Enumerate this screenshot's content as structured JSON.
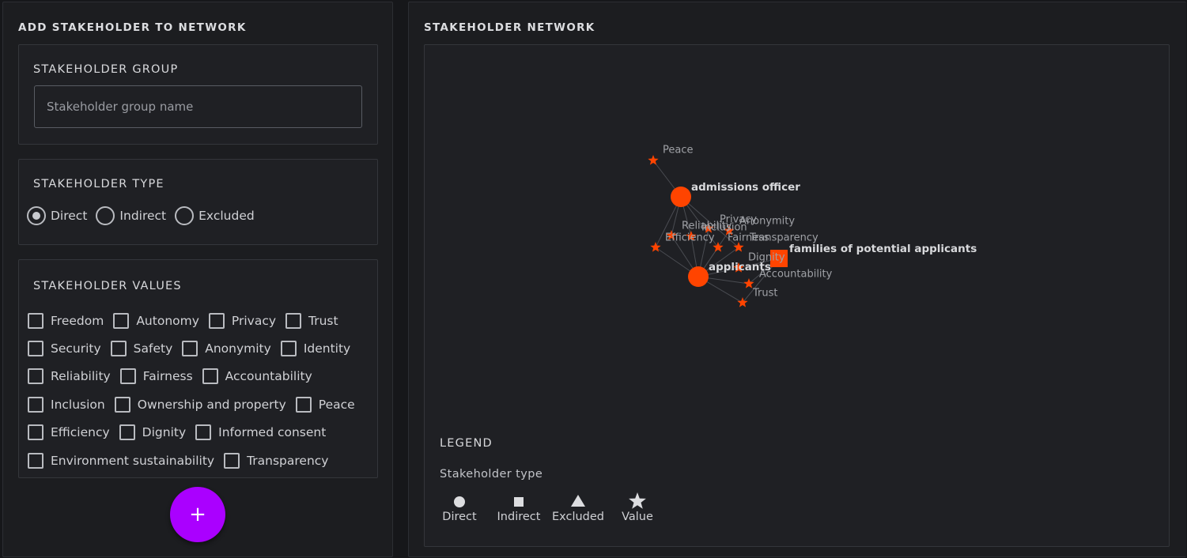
{
  "left_panel": {
    "title": "ADD STAKEHOLDER TO NETWORK",
    "group": {
      "title": "STAKEHOLDER GROUP",
      "input_value": "",
      "input_placeholder": "Stakeholder group name"
    },
    "type": {
      "title": "STAKEHOLDER TYPE",
      "options": [
        "Direct",
        "Indirect",
        "Excluded"
      ],
      "selected": "Direct"
    },
    "values": {
      "title": "STAKEHOLDER VALUES",
      "rows": [
        [
          "Freedom",
          "Autonomy",
          "Privacy",
          "Trust"
        ],
        [
          "Security",
          "Safety",
          "Anonymity",
          "Identity"
        ],
        [
          "Reliability",
          "Fairness",
          "Accountability"
        ],
        [
          "Inclusion",
          "Ownership and property",
          "Peace"
        ],
        [
          "Efficiency",
          "Dignity",
          "Informed consent"
        ],
        [
          "Environment sustainability",
          "Transparency"
        ]
      ],
      "checked": []
    },
    "add_button_label": "+",
    "add_button_color": "#aa00ff"
  },
  "right_panel": {
    "title": "STAKEHOLDER NETWORK",
    "legend": {
      "title": "LEGEND",
      "subtitle": "Stakeholder type",
      "items": [
        {
          "label": "Direct",
          "icon": "circle-icon"
        },
        {
          "label": "Indirect",
          "icon": "square-icon"
        },
        {
          "label": "Excluded",
          "icon": "triangle-icon"
        },
        {
          "label": "Value",
          "icon": "star-icon"
        }
      ]
    }
  },
  "network": {
    "node_color": "#ff4400",
    "stakeholders": [
      {
        "id": "admissions officer",
        "label": "admissions officer",
        "type": "Direct"
      },
      {
        "id": "applicants",
        "label": "applicants",
        "type": "Direct"
      },
      {
        "id": "families of potential applicants",
        "label": "families of potential applicants",
        "type": "Indirect"
      }
    ],
    "values": [
      {
        "id": "Peace",
        "label": "Peace"
      },
      {
        "id": "Privacy",
        "label": "Privacy"
      },
      {
        "id": "Anonymity",
        "label": "Anonymity"
      },
      {
        "id": "Reliability",
        "label": "Reliability"
      },
      {
        "id": "Inclusion",
        "label": "Inclusion"
      },
      {
        "id": "Efficiency",
        "label": "Efficiency"
      },
      {
        "id": "Fairness",
        "label": "Fairness"
      },
      {
        "id": "Transparency",
        "label": "Transparency"
      },
      {
        "id": "Dignity",
        "label": "Dignity"
      },
      {
        "id": "Accountability",
        "label": "Accountability"
      },
      {
        "id": "Trust",
        "label": "Trust"
      }
    ],
    "edges": [
      [
        "admissions officer",
        "Peace"
      ],
      [
        "admissions officer",
        "Efficiency"
      ],
      [
        "admissions officer",
        "Reliability"
      ],
      [
        "admissions officer",
        "Inclusion"
      ],
      [
        "admissions officer",
        "Fairness"
      ],
      [
        "admissions officer",
        "Transparency"
      ],
      [
        "applicants",
        "Efficiency"
      ],
      [
        "applicants",
        "Reliability"
      ],
      [
        "applicants",
        "Inclusion"
      ],
      [
        "applicants",
        "Privacy"
      ],
      [
        "applicants",
        "Fairness"
      ],
      [
        "applicants",
        "Anonymity"
      ],
      [
        "applicants",
        "Transparency"
      ],
      [
        "applicants",
        "Dignity"
      ],
      [
        "applicants",
        "Accountability"
      ],
      [
        "applicants",
        "Trust"
      ],
      [
        "families of potential applicants",
        "Dignity"
      ],
      [
        "families of potential applicants",
        "Accountability"
      ],
      [
        "families of potential applicants",
        "Trust"
      ]
    ]
  }
}
